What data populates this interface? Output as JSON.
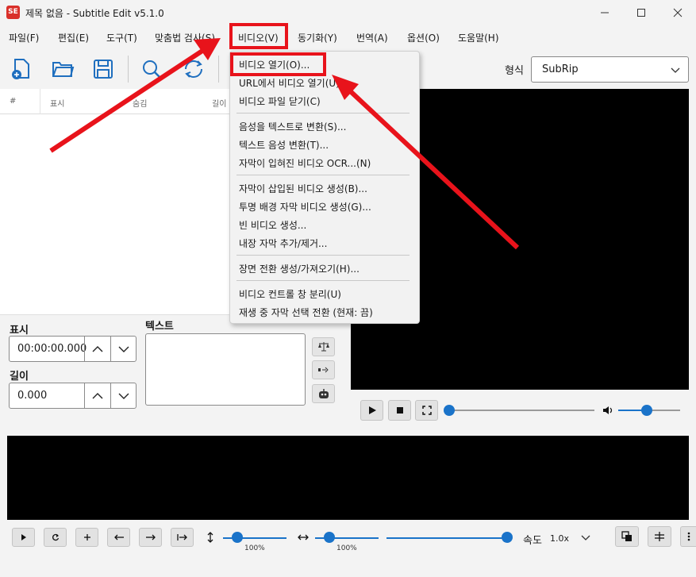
{
  "window": {
    "title": "제목 없음 - Subtitle Edit v5.1.0",
    "app_icon": "SE"
  },
  "menu": [
    {
      "label": "파일(F)"
    },
    {
      "label": "편집(E)"
    },
    {
      "label": "도구(T)"
    },
    {
      "label": "맞춤법 검사(S)"
    },
    {
      "label": "비디오(V)"
    },
    {
      "label": "동기화(Y)"
    },
    {
      "label": "번역(A)"
    },
    {
      "label": "옵션(O)"
    },
    {
      "label": "도움말(H)"
    }
  ],
  "toolbar": {
    "format_label": "형식",
    "format_value": "SubRip"
  },
  "grid": {
    "columns": [
      "#",
      "표시",
      "숨김",
      "길이"
    ]
  },
  "editor": {
    "show_label": "표시",
    "show_value": "00:00:00.000",
    "duration_label": "길이",
    "duration_value": "0.000",
    "text_label": "텍스트"
  },
  "video_menu": {
    "items": [
      "비디오 열기(O)...",
      "URL에서 비디오 열기(U)...",
      "비디오 파일 닫기(C)",
      "음성을 텍스트로 변환(S)...",
      "텍스트 음성 변환(T)...",
      "자막이 입혀진 비디오 OCR...(N)",
      "자막이 삽입된 비디오 생성(B)...",
      "투명 배경 자막 비디오 생성(G)...",
      "빈 비디오 생성...",
      "내장 자막 추가/제거...",
      "장면 전환 생성/가져오기(H)...",
      "비디오 컨트롤 창 분리(U)",
      "재생 중 자막 선택 전환 (현재: 끔)"
    ]
  },
  "waveform": {
    "vertical_zoom": "100%",
    "horizontal_zoom": "100%",
    "speed_label": "속도",
    "speed_value": "1.0x"
  },
  "colors": {
    "accent": "#1a73c9",
    "highlight": "#e8131b"
  }
}
